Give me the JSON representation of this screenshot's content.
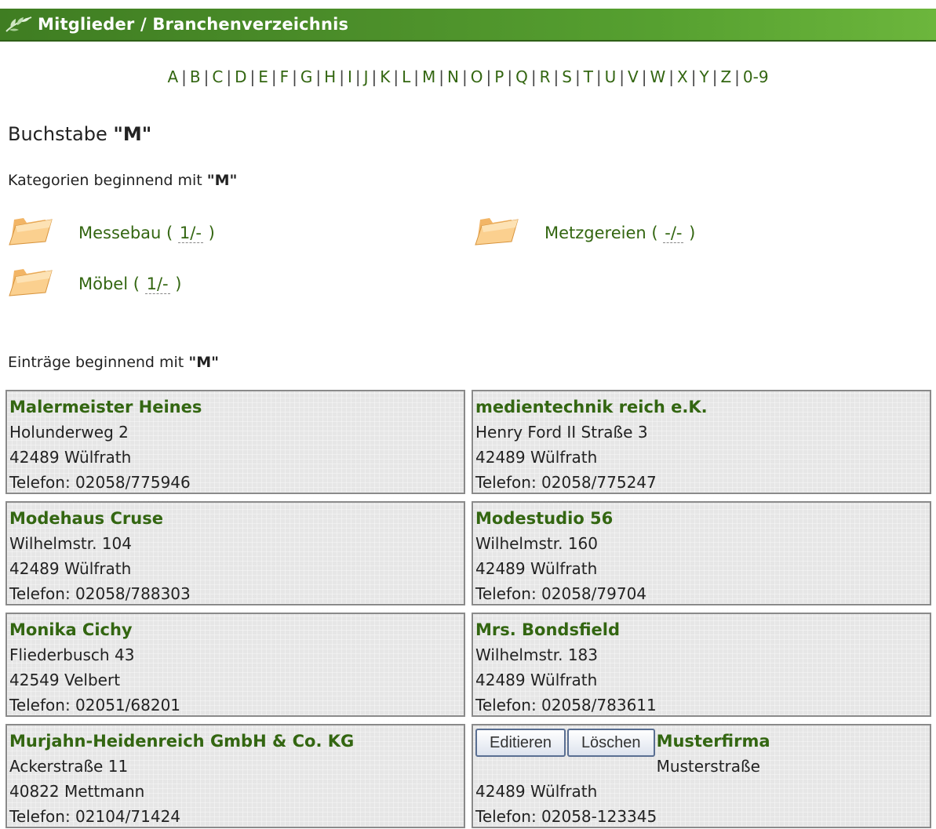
{
  "header": {
    "title": "Mitglieder / Branchenverzeichnis",
    "accent": "#4c8f2a"
  },
  "alphabet": [
    "A",
    "B",
    "C",
    "D",
    "E",
    "F",
    "G",
    "H",
    "I",
    "J",
    "K",
    "L",
    "M",
    "N",
    "O",
    "P",
    "Q",
    "R",
    "S",
    "T",
    "U",
    "V",
    "W",
    "X",
    "Y",
    "Z",
    "0-9"
  ],
  "letter_heading": {
    "prefix": "Buchstabe",
    "letter": "\"M\""
  },
  "categories_heading": {
    "prefix": "Kategorien beginnend mit",
    "letter": "\"M\""
  },
  "categories": [
    {
      "name": "Messebau",
      "count": "1/-"
    },
    {
      "name": "Metzgereien",
      "count": "-/-"
    },
    {
      "name": "Möbel",
      "count": "1/-"
    }
  ],
  "entries_heading": {
    "prefix": "Einträge beginnend mit",
    "letter": "\"M\""
  },
  "entries": [
    {
      "name": "Malermeister Heines",
      "street": "Holunderweg 2",
      "city": "42489 Wülfrath",
      "phone": "Telefon: 02058/775946"
    },
    {
      "name": "medientechnik reich e.K.",
      "street": "Henry Ford II Straße 3",
      "city": "42489 Wülfrath",
      "phone": "Telefon: 02058/775247"
    },
    {
      "name": "Modehaus Cruse",
      "street": "Wilhelmstr. 104",
      "city": "42489 Wülfrath",
      "phone": "Telefon: 02058/788303"
    },
    {
      "name": "Modestudio 56",
      "street": "Wilhelmstr. 160",
      "city": "42489 Wülfrath",
      "phone": "Telefon: 02058/79704"
    },
    {
      "name": "Monika Cichy",
      "street": "Fliederbusch 43",
      "city": "42549 Velbert",
      "phone": "Telefon: 02051/68201"
    },
    {
      "name": "Mrs. Bondsfield",
      "street": "Wilhelmstr. 183",
      "city": "42489 Wülfrath",
      "phone": "Telefon: 02058/783611"
    },
    {
      "name": "Murjahn-Heidenreich GmbH & Co. KG",
      "street": "Ackerstraße 11",
      "city": "40822 Mettmann",
      "phone": "Telefon: 02104/71424"
    },
    {
      "name": "Musterfirma",
      "street": "Musterstraße",
      "city": "42489 Wülfrath",
      "phone": "Telefon: 02058-123345",
      "buttons": {
        "edit": "Editieren",
        "delete": "Löschen"
      }
    }
  ]
}
